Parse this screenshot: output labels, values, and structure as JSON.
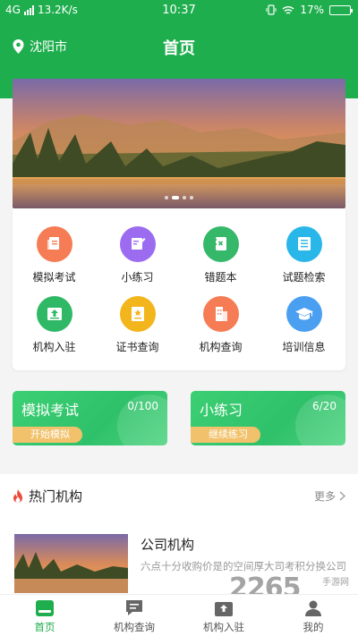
{
  "status_bar": {
    "network": "4G",
    "speed": "13.2K/s",
    "time": "10:37",
    "battery": "17%",
    "battery_level": 0.17
  },
  "header": {
    "location": "沈阳市",
    "title": "首页"
  },
  "banner": {
    "slide_count": 4,
    "active_slide": 1
  },
  "grid": [
    {
      "label": "模拟考试",
      "icon": "document-icon",
      "color": "#f57c54"
    },
    {
      "label": "小练习",
      "icon": "pencil-note-icon",
      "color": "#9b6cf0"
    },
    {
      "label": "错题本",
      "icon": "notebook-icon",
      "color": "#35b869"
    },
    {
      "label": "试题检索",
      "icon": "list-icon",
      "color": "#29b6e8"
    },
    {
      "label": "机构入驻",
      "icon": "upload-box-icon",
      "color": "#2fb865"
    },
    {
      "label": "证书查询",
      "icon": "certificate-icon",
      "color": "#f3b51c"
    },
    {
      "label": "机构查询",
      "icon": "building-icon",
      "color": "#f57c54"
    },
    {
      "label": "培训信息",
      "icon": "graduation-cap-icon",
      "color": "#4a9ff0"
    }
  ],
  "progress_cards": [
    {
      "title": "模拟考试",
      "count": "0/100",
      "button": "开始模拟"
    },
    {
      "title": "小练习",
      "count": "6/20",
      "button": "继续练习"
    }
  ],
  "hot": {
    "title": "热门机构",
    "more": "更多",
    "org": {
      "name": "公司机构",
      "desc": "六点十分收购价是的空间厚大司考积分换公司"
    }
  },
  "tabbar": [
    {
      "label": "首页",
      "icon": "home-icon",
      "active": true
    },
    {
      "label": "机构查询",
      "icon": "chat-icon",
      "active": false
    },
    {
      "label": "机构入驻",
      "icon": "upload-icon",
      "active": false
    },
    {
      "label": "我的",
      "icon": "profile-icon",
      "active": false
    }
  ],
  "watermark": {
    "number": "2265",
    "text": "手游网"
  },
  "colors": {
    "primary": "#1fae4e",
    "card_gradient": "#3ccf73",
    "button_yellow": "#f1c26b",
    "flame": "#ee4a3a"
  }
}
